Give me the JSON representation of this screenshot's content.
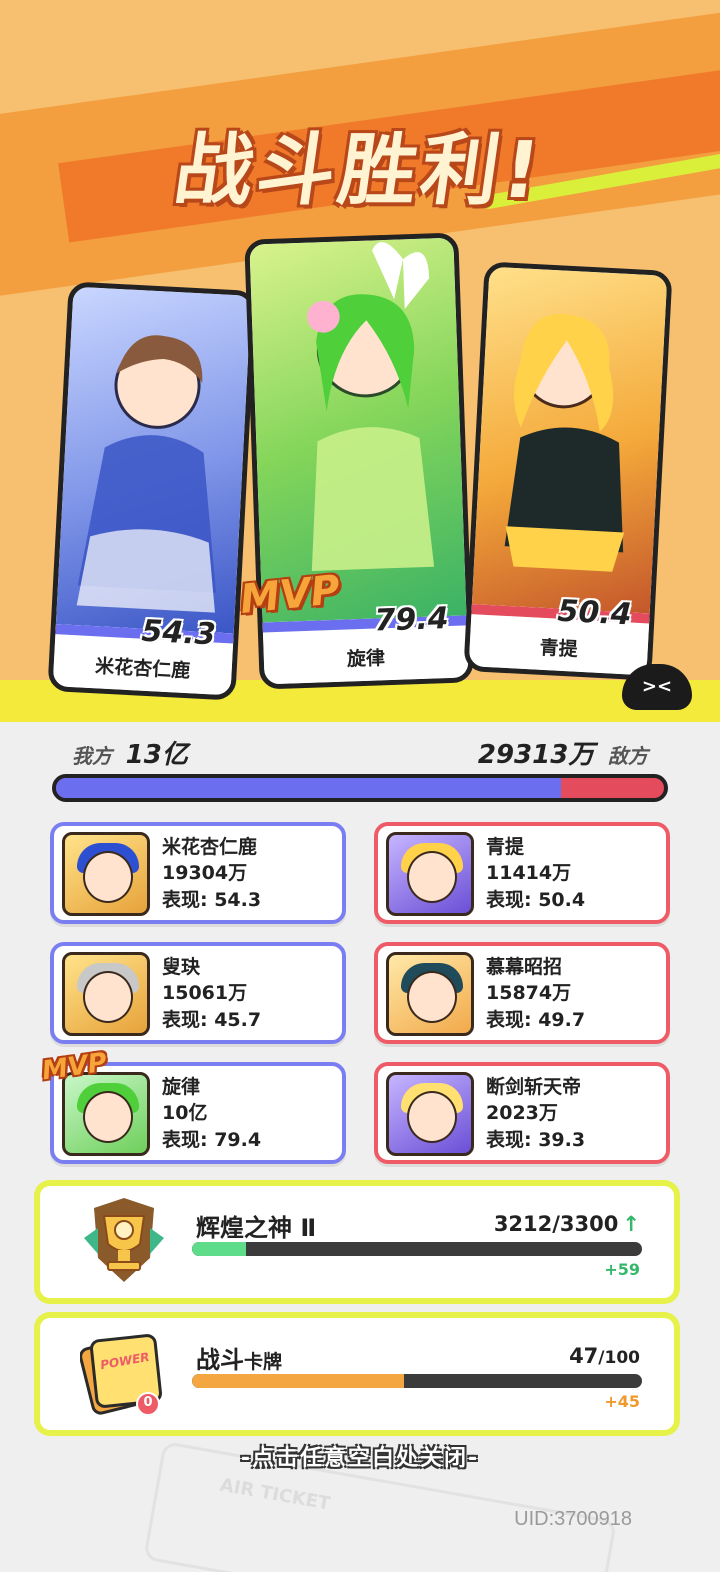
{
  "banner": {
    "title": "战斗胜利!",
    "mvp_label": "MVP"
  },
  "heroes": [
    {
      "name": "米花杏仁鹿",
      "score": "54.3"
    },
    {
      "name": "旋律",
      "score": "79.4"
    },
    {
      "name": "青提",
      "score": "50.4"
    }
  ],
  "mascot": {
    "face": "><"
  },
  "scoreboard": {
    "ally_label": "我方",
    "ally_total": "13亿",
    "enemy_total": "29313万",
    "enemy_label": "敌方",
    "ally_share": 0.83
  },
  "allies": [
    {
      "name": "米花杏仁鹿",
      "damage": "19304万",
      "performance": "表现: 54.3"
    },
    {
      "name": "叟玦",
      "damage": "15061万",
      "performance": "表现: 45.7"
    },
    {
      "name": "旋律",
      "damage": "10亿",
      "performance": "表现: 79.4",
      "mvp": "MVP"
    }
  ],
  "enemies": [
    {
      "name": "青提",
      "damage": "11414万",
      "performance": "表现: 50.4"
    },
    {
      "name": "慕幕昭招",
      "damage": "15874万",
      "performance": "表现: 49.7"
    },
    {
      "name": "断剑斩天帝",
      "damage": "2023万",
      "performance": "表现: 39.3"
    }
  ],
  "rank_panel": {
    "title": "辉煌之神 Ⅱ",
    "count": "3212/3300",
    "arrow": "↑",
    "gain": "+59",
    "progress": 0.12,
    "bar_color": "#5fdc8a",
    "gain_color": "#35b86b",
    "emblem": "trophy-icon"
  },
  "card_panel": {
    "title_main": "战斗",
    "title_small": "卡牌",
    "count": "47",
    "count_max": "/100",
    "gain": "+45",
    "progress": 0.47,
    "bar_color": "#f4a640",
    "gain_color": "#f09a2e",
    "emblem": "power-card-icon",
    "emblem_text": "POWER",
    "emblem_badge": "0"
  },
  "footer": {
    "close_hint": "-点击任意空白处关闭-",
    "uid": "UID:3700918",
    "ticket_text": "AIR TICKET"
  }
}
